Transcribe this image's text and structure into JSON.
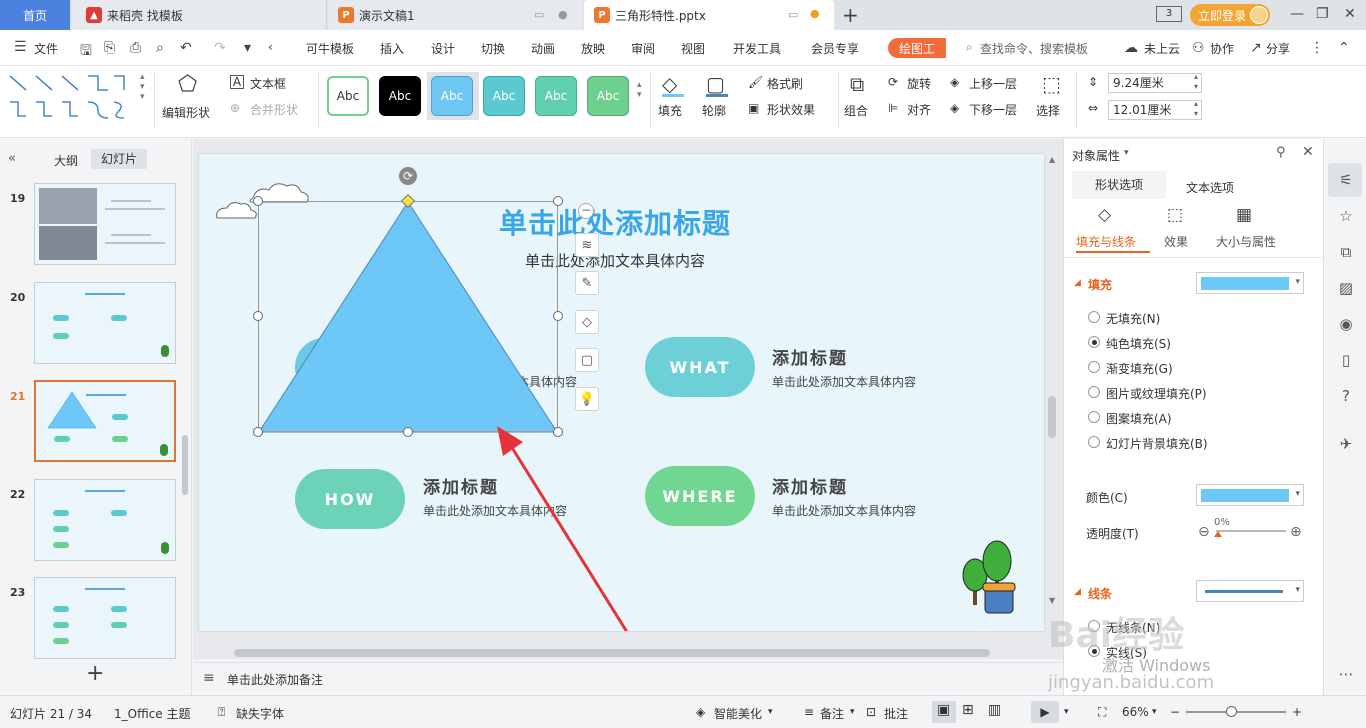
{
  "tabs": {
    "home": "首页",
    "doc1": "来稻壳 找模板",
    "doc2": "演示文稿1",
    "doc3": "三角形特性.pptx",
    "login": "立即登录",
    "counter": "3"
  },
  "menu": {
    "file": "文件",
    "items": [
      "可牛模板",
      "插入",
      "设计",
      "切换",
      "动画",
      "放映",
      "审阅",
      "视图",
      "开发工具",
      "会员专享"
    ],
    "drawing_tab": "绘图工",
    "search": "查找命令、搜索模板",
    "cloud": "未上云",
    "collab": "协作",
    "share": "分享"
  },
  "ribbon": {
    "edit_shape": "编辑形状",
    "textbox": "文本框",
    "merge_shape": "合并形状",
    "style_label": "Abc",
    "fill": "填充",
    "outline": "轮廓",
    "format_brush": "格式刷",
    "shape_effect": "形状效果",
    "group": "组合",
    "rotate": "旋转",
    "align": "对齐",
    "bring_forward": "上移一层",
    "send_backward": "下移一层",
    "select": "选择",
    "height": "9.24厘米",
    "width": "12.01厘米",
    "colors": {
      "white_green": "#ffffff",
      "black": "#000000",
      "blue": "#6ec6f2",
      "teal": "#5cc8d0",
      "green1": "#5fcfb0",
      "green2": "#6dd08f"
    }
  },
  "left_panel": {
    "outline_tab": "大纲",
    "slides_tab": "幻灯片",
    "slides": [
      {
        "num": "19"
      },
      {
        "num": "20"
      },
      {
        "num": "21"
      },
      {
        "num": "22"
      },
      {
        "num": "23"
      }
    ],
    "add": "+"
  },
  "slide": {
    "title": "单击此处添加标题",
    "subtitle": "单击此处添加文本具体内容",
    "items": [
      {
        "pill": "WHAT",
        "title": "添加标题",
        "text": "单击此处添加文本具体内容",
        "color": "#6dd0d6"
      },
      {
        "pill": "HOW",
        "title": "添加标题",
        "text": "单击此处添加文本具体内容",
        "color": "#6cd3b8"
      },
      {
        "pill": "WHERE",
        "title": "添加标题",
        "text": "单击此处添加文本具体内容",
        "color": "#72d693"
      }
    ],
    "hidden_text": "本具体内容",
    "triangle_color": "#6ec8f7",
    "arrow_color": "#e8323a"
  },
  "notes": {
    "placeholder": "单击此处添加备注"
  },
  "right_panel": {
    "title": "对象属性",
    "tab_shape": "形状选项",
    "tab_text": "文本选项",
    "sub_fill_line": "填充与线条",
    "sub_effect": "效果",
    "sub_size": "大小与属性",
    "fill_section": "填充",
    "fill_options": [
      "无填充(N)",
      "纯色填充(S)",
      "渐变填充(G)",
      "图片或纹理填充(P)",
      "图案填充(A)",
      "幻灯片背景填充(B)"
    ],
    "color_label": "颜色(C)",
    "transparency_label": "透明度(T)",
    "transparency_value": "0%",
    "line_section": "线条",
    "line_options": [
      "无线条(N)",
      "实线(S)"
    ],
    "fill_color": "#6ec8f7",
    "line_color": "#4a86b5"
  },
  "status": {
    "slide_pos": "幻灯片 21 / 34",
    "theme": "1_Office 主题",
    "missing_font": "缺失字体",
    "beautify": "智能美化",
    "notes": "备注",
    "comments": "批注",
    "zoom": "66%"
  },
  "watermark": {
    "line1": "Bai经验",
    "line2": "激活 Windows",
    "line3": "jingyan.baidu.com"
  }
}
